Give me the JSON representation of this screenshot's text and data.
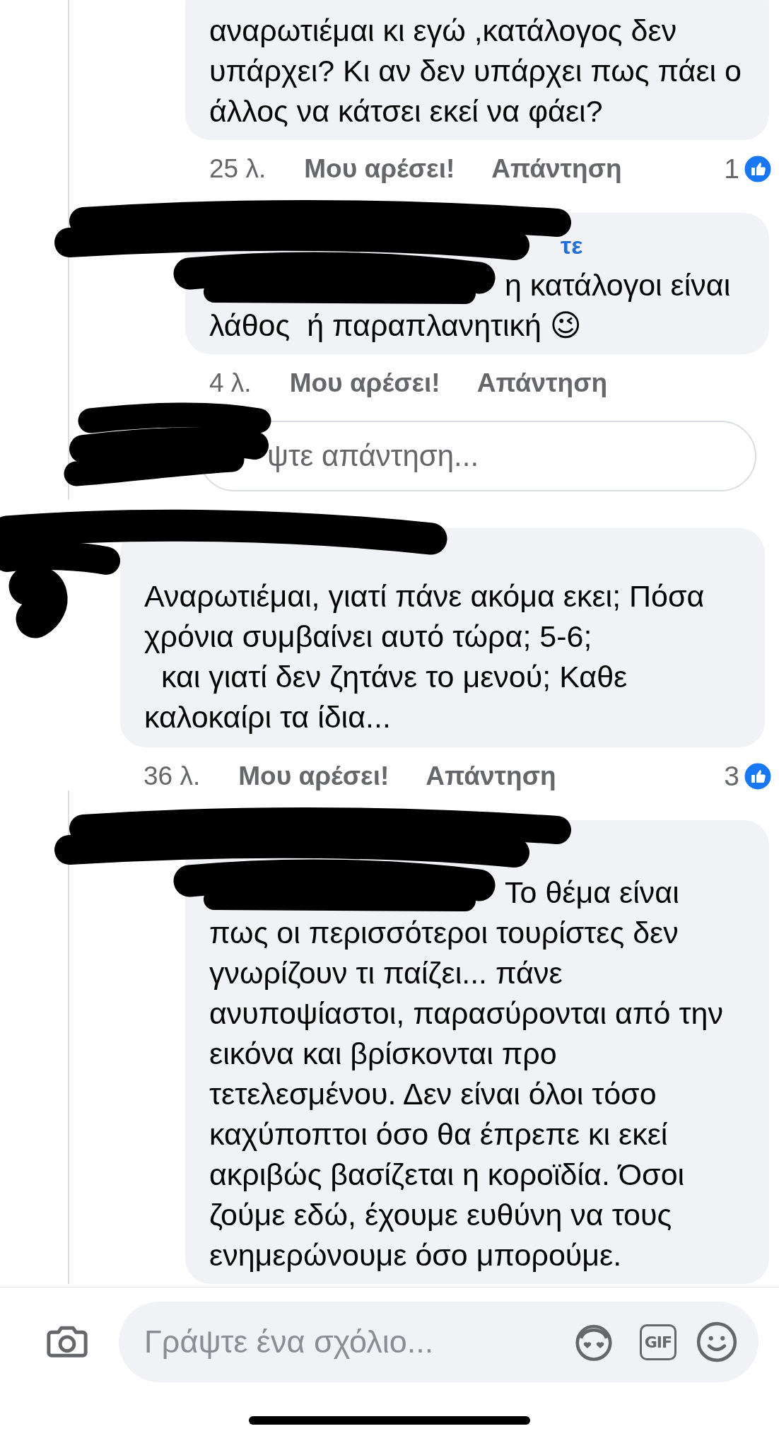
{
  "threads": [
    {
      "replies": [
        {
          "text": "αναρωτιέμαι κι εγώ ,κατάλογος δεν υπάρχει? Κι αν δεν υπάρχει πως πάει ο άλλος να κάτσει εκεί να φάει?",
          "redacted": false,
          "time": "25 λ.",
          "like_action": "Μου αρέσει!",
          "reply_action": "Απάντηση",
          "reactions": "1"
        },
        {
          "author": "τε",
          "text": "η κατάλογοι είναι λάθος  ή παραπλανητική 😉",
          "redacted": true,
          "time": "4 λ.",
          "like_action": "Μου αρέσει!",
          "reply_action": "Απάντηση"
        }
      ],
      "reply_field": {
        "placeholder": "ψτε απάντηση...",
        "redacted": true
      }
    },
    {
      "comment": {
        "text": "Αναρωτιέμαι, γιατί πάνε ακόμα εκει; Πόσα χρόνια συμβαίνει αυτό τώρα; 5-6;\n  και γιατί δεν ζητάνε το μενού; Καθε καλοκαίρι τα ίδια...",
        "redacted": true,
        "time": "36 λ.",
        "like_action": "Μου αρέσει!",
        "reply_action": "Απάντηση",
        "reactions": "3"
      },
      "replies": [
        {
          "text": "Το θέμα είναι πως οι περισσότεροι τουρίστες δεν γνωρίζουν τι παίζει... πάνε ανυποψίαστοι, παρασύρονται από την εικόνα και βρίσκονται προ τετελεσμένου. Δεν είναι όλοι τόσο καχύποπτοι όσο θα έπρεπε κι εκεί ακριβώς βασίζεται η κοροϊδία. Όσοι ζούμε εδώ, έχουμε ευθύνη να τους ενημερώνουμε όσο μπορούμε.",
          "redacted": true
        }
      ]
    }
  ],
  "composer": {
    "placeholder": "Γράψτε ένα σχόλιο...",
    "gif_label": "GIF"
  }
}
